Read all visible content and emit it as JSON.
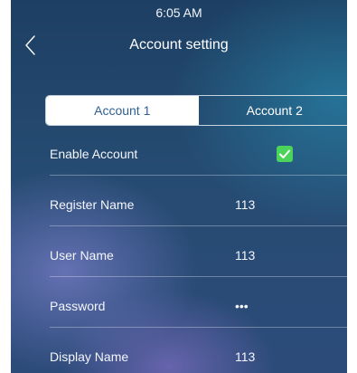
{
  "status_bar": {
    "time": "6:05 AM"
  },
  "header": {
    "title": "Account setting",
    "back_icon": "chevron-left-icon"
  },
  "tabs": [
    {
      "label": "Account 1",
      "active": true
    },
    {
      "label": "Account 2",
      "active": false
    }
  ],
  "fields": {
    "enable_account": {
      "label": "Enable Account",
      "checked": true,
      "check_color": "#4cd35a"
    },
    "register_name": {
      "label": "Register Name",
      "value": "113"
    },
    "user_name": {
      "label": "User Name",
      "value": "113"
    },
    "password": {
      "label": "Password",
      "value": "•••"
    },
    "display_name": {
      "label": "Display Name",
      "value": "113"
    }
  }
}
